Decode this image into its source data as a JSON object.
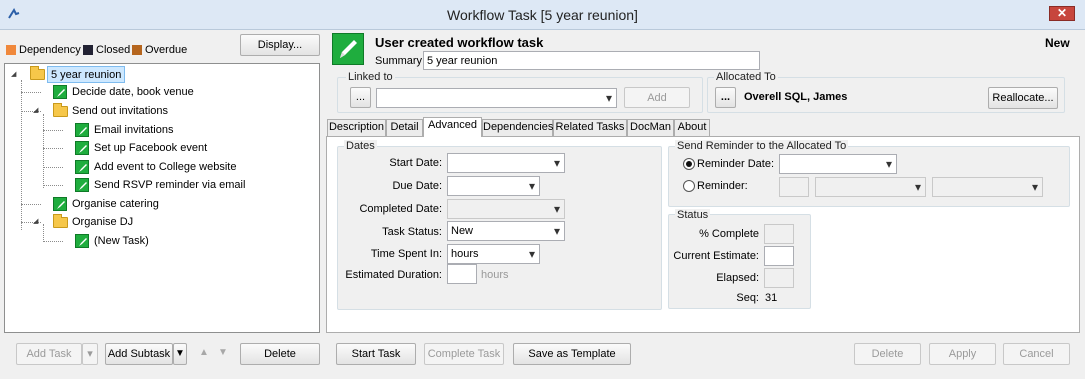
{
  "window": {
    "title": "Workflow Task  [5 year reunion]",
    "close_label": "✕"
  },
  "legend": [
    {
      "label": "Dependency",
      "color": "#f0883b"
    },
    {
      "label": "Closed",
      "color": "#222233"
    },
    {
      "label": "Overdue",
      "color": "#b5651d"
    }
  ],
  "display_button": "Display...",
  "tree": {
    "root": "5 year reunion",
    "items": [
      "Decide date, book venue",
      "Send out invitations",
      "Email invitations",
      "Set up Facebook event",
      "Add event to College website",
      "Send RSVP reminder via email",
      "Organise catering",
      "Organise DJ",
      "(New Task)"
    ]
  },
  "header": {
    "heading": "User created workflow task",
    "status": "New",
    "summary_label": "Summary:",
    "summary_value": "5 year reunion"
  },
  "linked": {
    "label": "Linked to",
    "browse": "...",
    "add": "Add"
  },
  "allocated": {
    "label": "Allocated To",
    "browse": "...",
    "name": "Overell SQL, James",
    "reallocate": "Reallocate..."
  },
  "tabs": [
    "Description",
    "Detail",
    "Advanced",
    "Dependencies",
    "Related Tasks",
    "DocMan",
    "About"
  ],
  "dates": {
    "label": "Dates",
    "start": "Start Date:",
    "due": "Due Date:",
    "completed": "Completed Date:",
    "task_status": "Task Status:",
    "task_status_value": "New",
    "time_spent": "Time Spent In:",
    "time_spent_value": "hours",
    "est_duration": "Estimated Duration:",
    "hours_unit": "hours"
  },
  "reminder": {
    "label": "Send Reminder to the Allocated To",
    "option_date": "Reminder Date:",
    "option_reminder": "Reminder:"
  },
  "status": {
    "label": "Status",
    "complete": "% Complete",
    "current_est": "Current Estimate:",
    "elapsed": "Elapsed:",
    "seq_label": "Seq:",
    "seq_value": "31"
  },
  "footer": {
    "add_task": "Add Task",
    "add_subtask": "Add Subtask",
    "delete": "Delete",
    "start_task": "Start Task",
    "complete_task": "Complete Task",
    "save_template": "Save as Template",
    "delete2": "Delete",
    "apply": "Apply",
    "cancel": "Cancel"
  }
}
